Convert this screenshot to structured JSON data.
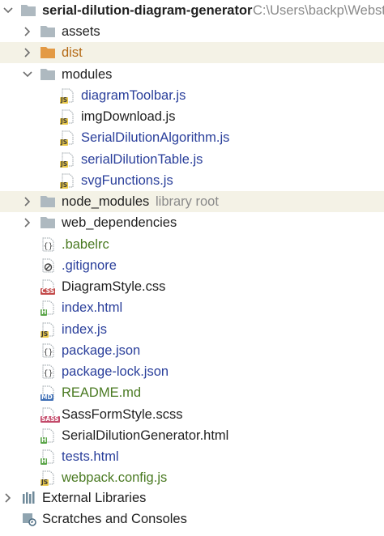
{
  "project": {
    "name": "serial-dilution-diagram-generator",
    "path": "C:\\Users\\backp\\Webstc"
  },
  "tree": [
    {
      "label": "assets",
      "kind": "folder",
      "expanded": false
    },
    {
      "label": "dist",
      "kind": "folder-excluded",
      "expanded": false
    },
    {
      "label": "modules",
      "kind": "folder",
      "expanded": true
    },
    {
      "label": "diagramToolbar.js",
      "kind": "js",
      "status": "modified"
    },
    {
      "label": "imgDownload.js",
      "kind": "js",
      "status": "normal"
    },
    {
      "label": "SerialDilutionAlgorithm.js",
      "kind": "js",
      "status": "modified"
    },
    {
      "label": "serialDilutionTable.js",
      "kind": "js",
      "status": "modified"
    },
    {
      "label": "svgFunctions.js",
      "kind": "js",
      "status": "modified"
    },
    {
      "label": "node_modules",
      "kind": "folder-library",
      "expanded": false,
      "hint": "library root"
    },
    {
      "label": "web_dependencies",
      "kind": "folder",
      "expanded": false
    },
    {
      "label": ".babelrc",
      "kind": "config",
      "status": "added"
    },
    {
      "label": ".gitignore",
      "kind": "ignore",
      "status": "modified"
    },
    {
      "label": "DiagramStyle.css",
      "kind": "css",
      "status": "normal"
    },
    {
      "label": "index.html",
      "kind": "html",
      "status": "modified"
    },
    {
      "label": "index.js",
      "kind": "js",
      "status": "modified"
    },
    {
      "label": "package.json",
      "kind": "config",
      "status": "modified"
    },
    {
      "label": "package-lock.json",
      "kind": "config",
      "status": "modified"
    },
    {
      "label": "README.md",
      "kind": "md",
      "status": "added"
    },
    {
      "label": "SassFormStyle.scss",
      "kind": "sass",
      "status": "normal"
    },
    {
      "label": "SerialDilutionGenerator.html",
      "kind": "html",
      "status": "normal"
    },
    {
      "label": "tests.html",
      "kind": "html",
      "status": "modified"
    },
    {
      "label": "webpack.config.js",
      "kind": "js",
      "status": "added"
    }
  ],
  "external_libraries": {
    "label": "External Libraries"
  },
  "scratches": {
    "label": "Scratches and Consoles"
  },
  "colors": {
    "modified": "#2a3f9b",
    "added": "#4a7a22",
    "excluded": "#b46914",
    "highlight": "#f4f2e6"
  }
}
